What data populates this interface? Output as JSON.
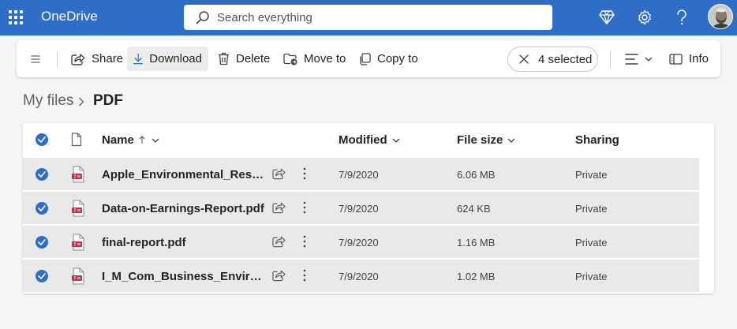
{
  "app": {
    "title": "OneDrive"
  },
  "search": {
    "placeholder": "Search everything"
  },
  "toolbar": {
    "share": "Share",
    "download": "Download",
    "delete": "Delete",
    "move_to": "Move to",
    "copy_to": "Copy to",
    "selected": "4 selected",
    "info": "Info"
  },
  "breadcrumb": {
    "parent": "My files",
    "current": "PDF"
  },
  "list": {
    "columns": {
      "name": "Name",
      "modified": "Modified",
      "file_size": "File size",
      "sharing": "Sharing"
    },
    "rows": [
      {
        "name": "Apple_Environmental_Responsibility_Report.pdf",
        "modified": "7/9/2020",
        "size": "6.06 MB",
        "sharing": "Private"
      },
      {
        "name": "Data-on-Earnings-Report.pdf",
        "modified": "7/9/2020",
        "size": "624 KB",
        "sharing": "Private"
      },
      {
        "name": "final-report.pdf",
        "modified": "7/9/2020",
        "size": "1.16 MB",
        "sharing": "Private"
      },
      {
        "name": "I_M_Com_Business_Environment.pdf",
        "modified": "7/9/2020",
        "size": "1.02 MB",
        "sharing": "Private"
      }
    ]
  },
  "colors": {
    "accent": "#2f6ec7",
    "selected_row": "#e9e9e9",
    "pdf_red": "#c4314b"
  }
}
